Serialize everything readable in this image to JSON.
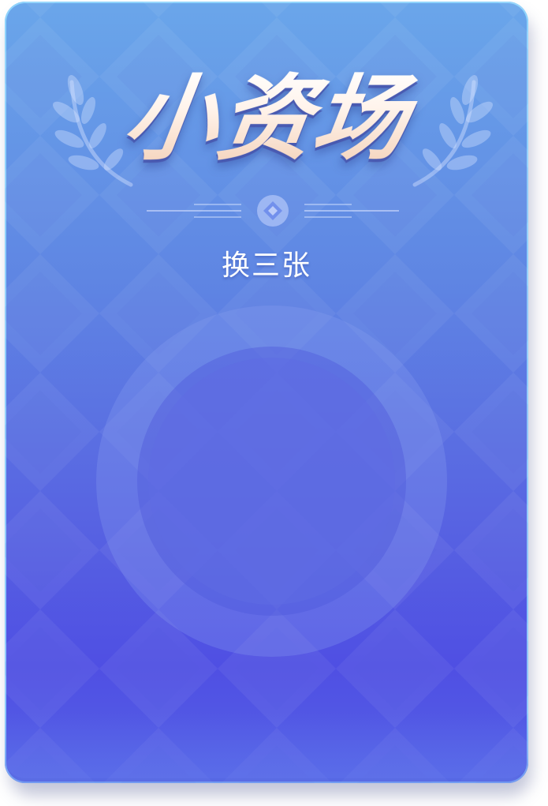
{
  "mode_card": {
    "title": "小资场",
    "subtitle": "换三张",
    "colors": {
      "gradient_top": "#6aa6ea",
      "gradient_bottom": "#4f4fe3",
      "border_glow": "#96dcff",
      "title_light": "#ffffff",
      "title_peach": "#f3cfb6"
    },
    "icons": {
      "left_decoration": "laurel-icon",
      "right_decoration": "laurel-icon",
      "divider_center": "diamond-icon",
      "center_emblem": "ring-emblem-icon"
    }
  }
}
